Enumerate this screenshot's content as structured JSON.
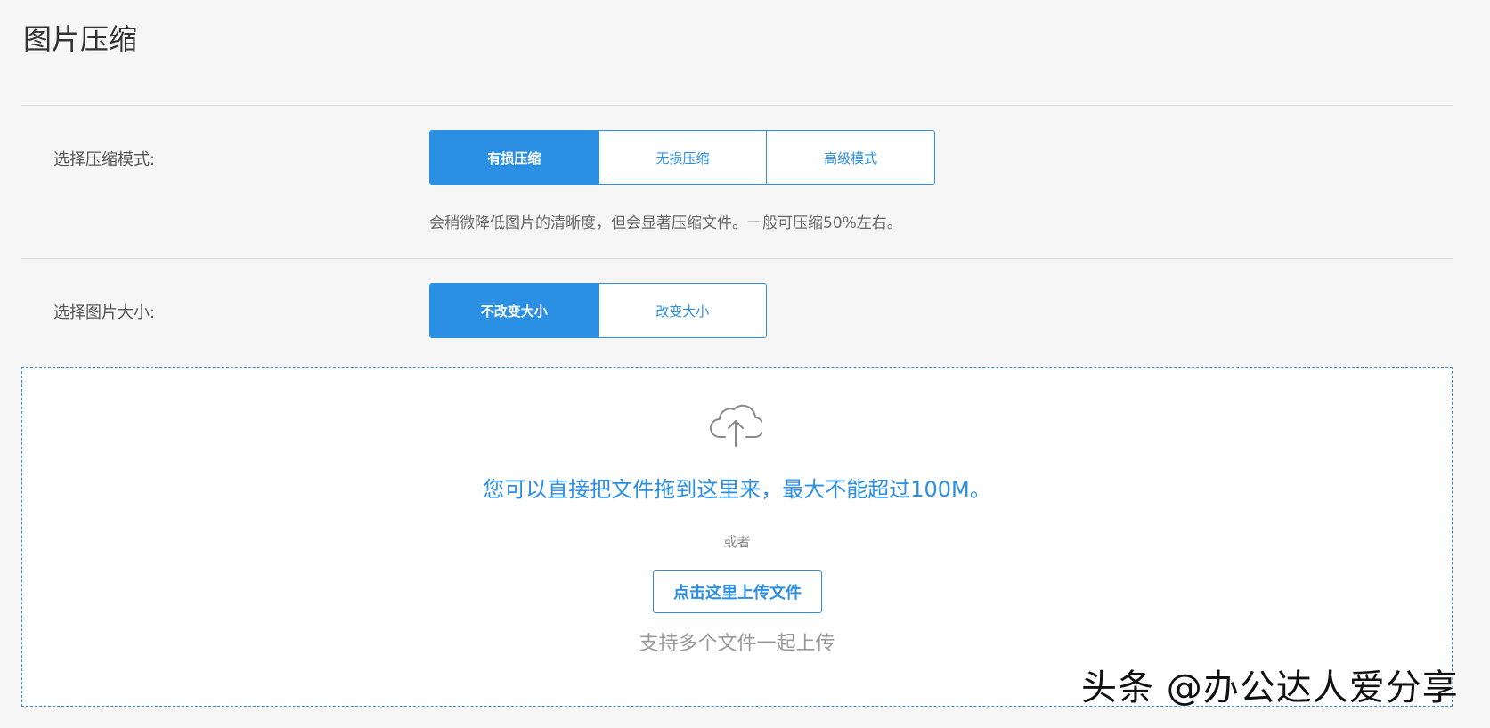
{
  "page": {
    "title": "图片压缩"
  },
  "compression_mode": {
    "label": "选择压缩模式:",
    "options": [
      "有损压缩",
      "无损压缩",
      "高级模式"
    ],
    "selected": "有损压缩",
    "description": "会稍微降低图片的清晰度，但会显著压缩文件。一般可压缩50%左右。"
  },
  "image_size": {
    "label": "选择图片大小:",
    "options": [
      "不改变大小",
      "改变大小"
    ],
    "selected": "不改变大小"
  },
  "upload": {
    "icon": "cloud-upload-icon",
    "headline": "您可以直接把文件拖到这里来，最大不能超过100M。",
    "or_text": "或者",
    "button_label": "点击这里上传文件",
    "hint": "支持多个文件一起上传"
  },
  "watermark": {
    "text": "头条 @办公达人爱分享"
  },
  "colors": {
    "accent": "#2b8fe3",
    "background": "#f6f6f6",
    "panel": "#ffffff"
  }
}
